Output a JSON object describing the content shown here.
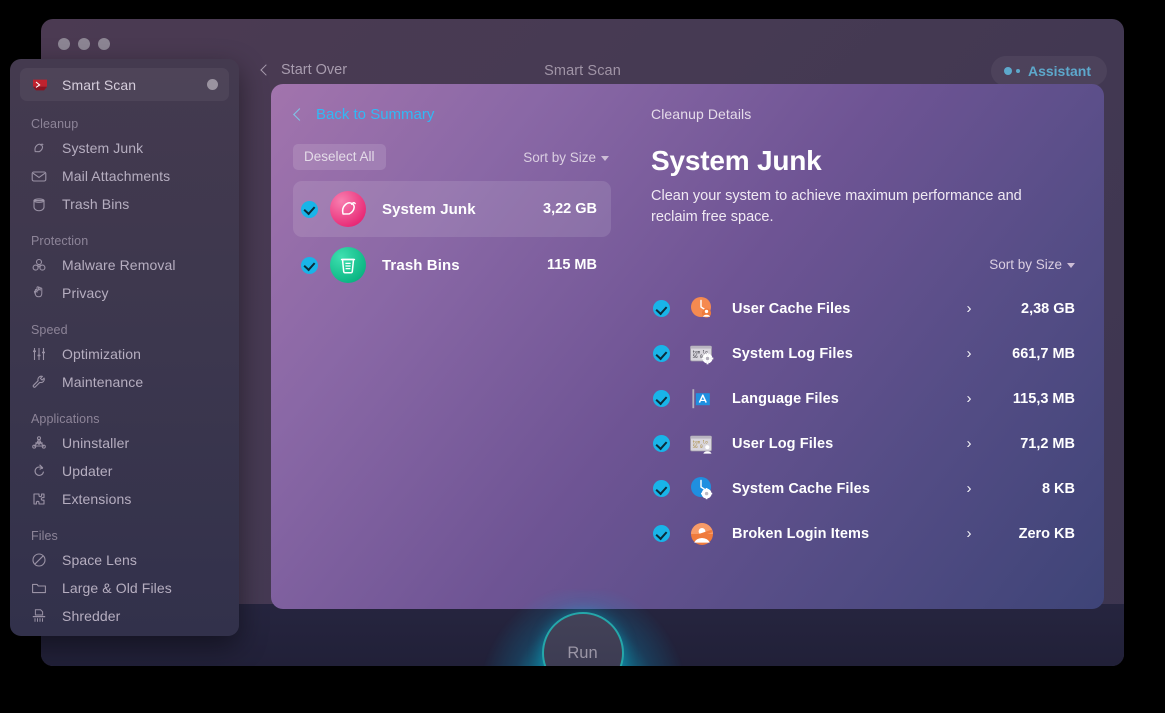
{
  "window": {
    "title": "Smart Scan",
    "start_over_label": "Start Over",
    "assistant_label": "Assistant",
    "run_label": "Run"
  },
  "sidebar": {
    "top": {
      "label": "Smart Scan",
      "icon": "smart-scan-icon"
    },
    "groups": [
      {
        "title": "Cleanup",
        "items": [
          {
            "label": "System Junk",
            "icon": "broom-icon"
          },
          {
            "label": "Mail Attachments",
            "icon": "envelope-icon"
          },
          {
            "label": "Trash Bins",
            "icon": "trash-bin-icon"
          }
        ]
      },
      {
        "title": "Protection",
        "items": [
          {
            "label": "Malware Removal",
            "icon": "biohazard-icon"
          },
          {
            "label": "Privacy",
            "icon": "hand-icon"
          }
        ]
      },
      {
        "title": "Speed",
        "items": [
          {
            "label": "Optimization",
            "icon": "sliders-icon"
          },
          {
            "label": "Maintenance",
            "icon": "wrench-icon"
          }
        ]
      },
      {
        "title": "Applications",
        "items": [
          {
            "label": "Uninstaller",
            "icon": "molecule-icon"
          },
          {
            "label": "Updater",
            "icon": "refresh-arrow-icon"
          },
          {
            "label": "Extensions",
            "icon": "puzzle-piece-icon"
          }
        ]
      },
      {
        "title": "Files",
        "items": [
          {
            "label": "Space Lens",
            "icon": "lens-circle-icon"
          },
          {
            "label": "Large & Old Files",
            "icon": "folder-icon"
          },
          {
            "label": "Shredder",
            "icon": "shredder-icon"
          }
        ]
      }
    ]
  },
  "card": {
    "back_label": "Back to Summary",
    "deselect_label": "Deselect All",
    "sort_label": "Sort by Size",
    "summary_items": [
      {
        "name": "System Junk",
        "size": "3,22 GB",
        "icon": "broom-circle-icon",
        "checked": true,
        "selected": true
      },
      {
        "name": "Trash Bins",
        "size": "115 MB",
        "icon": "trash-circle-icon",
        "checked": true,
        "selected": false
      }
    ],
    "details": {
      "eyebrow": "Cleanup Details",
      "title": "System Junk",
      "description": "Clean your system to achieve maximum performance and reclaim free space.",
      "sort_label": "Sort by Size",
      "rows": [
        {
          "name": "User Cache Files",
          "size": "2,38 GB",
          "icon": "user-cache-icon",
          "checked": true,
          "arrow": "›"
        },
        {
          "name": "System Log Files",
          "size": "661,7 MB",
          "icon": "system-log-icon",
          "checked": true,
          "arrow": "›"
        },
        {
          "name": "Language Files",
          "size": "115,3 MB",
          "icon": "language-files-icon",
          "checked": true,
          "arrow": "›"
        },
        {
          "name": "User Log Files",
          "size": "71,2 MB",
          "icon": "user-log-icon",
          "checked": true,
          "arrow": "›"
        },
        {
          "name": "System Cache Files",
          "size": "8 KB",
          "icon": "system-cache-icon",
          "checked": true,
          "arrow": "›"
        },
        {
          "name": "Broken Login Items",
          "size": "Zero KB",
          "icon": "broken-login-icon",
          "checked": true,
          "arrow": "›"
        }
      ]
    }
  },
  "colors": {
    "accent_blue": "#31b9f5",
    "check_blue": "#19b4e8",
    "assistant_blue": "#5da8cc",
    "run_ring": "#25a7aa",
    "junk_pink": "#e6206f",
    "trash_green": "#05b07d"
  }
}
